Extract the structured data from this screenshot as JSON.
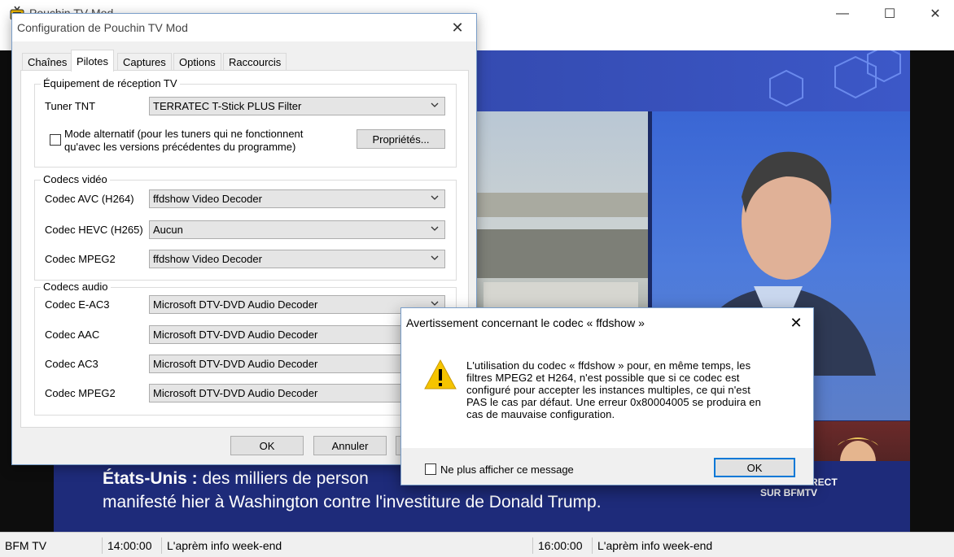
{
  "main_window": {
    "title": "Pouchin TV Mod",
    "controls": {
      "minimize": "—",
      "maximize": "☐",
      "close": "✕"
    }
  },
  "video": {
    "ticker_bold": "États-Unis :",
    "ticker_line1_rest": " des milliers de person",
    "ticker_line2": "manifesté hier à Washington contre l'investiture de Donald Trump.",
    "badge_line1": "DIRECT",
    "badge_line2": "SUR BFMTV"
  },
  "statusbar": {
    "channel": "BFM TV",
    "time1": "14:00:00",
    "program1": "L'aprèm info week-end",
    "time2": "16:00:00",
    "program2": "L'aprèm info week-end"
  },
  "config_dialog": {
    "title": "Configuration de Pouchin TV Mod",
    "close": "✕",
    "tabs": [
      "Chaînes",
      "Pilotes",
      "Captures",
      "Options",
      "Raccourcis"
    ],
    "active_tab": "Pilotes",
    "reception_group": {
      "label": "Équipement de réception TV",
      "tuner_label": "Tuner TNT",
      "tuner_value": "TERRATEC T-Stick PLUS Filter",
      "alt_mode_line1": "Mode alternatif (pour les tuners qui ne fonctionnent",
      "alt_mode_line2": "qu'avec les versions précédentes du programme)",
      "alt_mode_checked": false,
      "properties_button": "Propriétés..."
    },
    "video_group": {
      "label": "Codecs vidéo",
      "rows": [
        {
          "label": "Codec AVC (H264)",
          "value": "ffdshow Video Decoder"
        },
        {
          "label": "Codec HEVC (H265)",
          "value": "Aucun"
        },
        {
          "label": "Codec MPEG2",
          "value": "ffdshow Video Decoder"
        }
      ]
    },
    "audio_group": {
      "label": "Codecs audio",
      "rows": [
        {
          "label": "Codec E-AC3",
          "value": "Microsoft DTV-DVD Audio Decoder"
        },
        {
          "label": "Codec AAC",
          "value": "Microsoft DTV-DVD Audio Decoder"
        },
        {
          "label": "Codec AC3",
          "value": "Microsoft DTV-DVD Audio Decoder"
        },
        {
          "label": "Codec MPEG2",
          "value": "Microsoft DTV-DVD Audio Decoder"
        }
      ]
    },
    "ok_button": "OK",
    "cancel_button": "Annuler"
  },
  "warning_dialog": {
    "title": "Avertissement concernant le codec « ffdshow »",
    "close": "✕",
    "message_lines": [
      "L'utilisation du codec « ffdshow » pour, en même temps, les",
      "filtres MPEG2 et H264, n'est possible que si ce codec est",
      "configuré pour accepter les instances multiples, ce qui n'est",
      "PAS le cas par défaut. Une erreur 0x80004005 se produira en",
      "cas de mauvaise configuration."
    ],
    "dont_show_label": "Ne plus afficher ce message",
    "dont_show_checked": false,
    "ok_button": "OK",
    "icon": "warning-icon"
  },
  "colors": {
    "accent": "#0078d7",
    "warning_yellow": "#f5c400",
    "ticker_blue": "#1e2b7a"
  }
}
